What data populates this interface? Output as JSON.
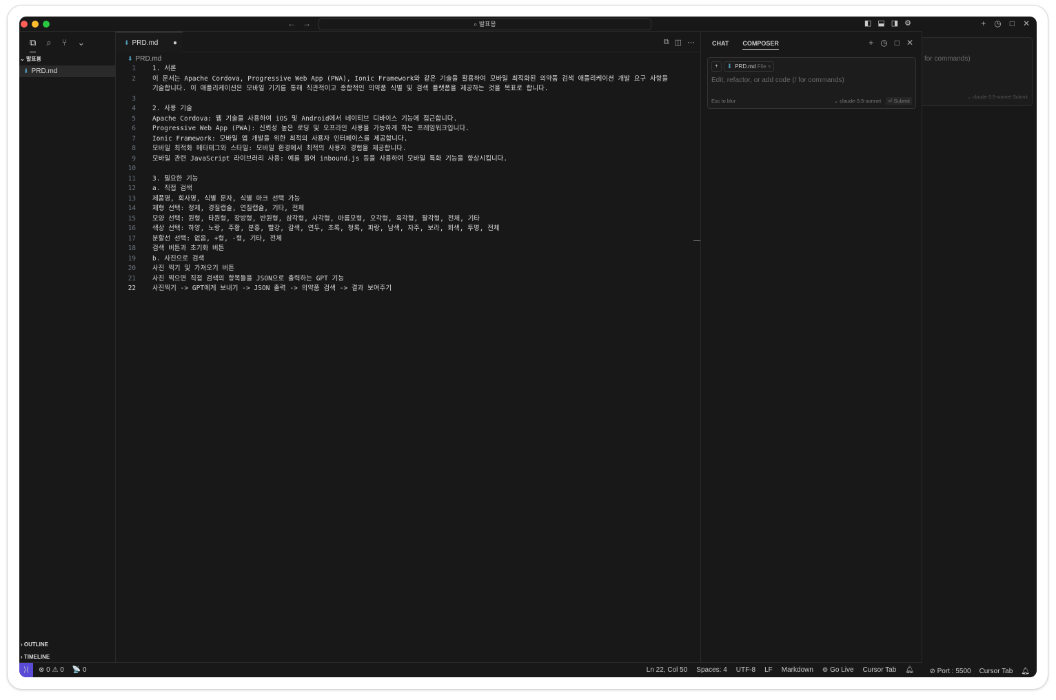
{
  "window": {
    "search": "⌕ 발표용",
    "nav_back": "←",
    "nav_fwd": "→"
  },
  "sidebar": {
    "folder": "발표용",
    "file": "PRD.md",
    "outline": "OUTLINE",
    "timeline": "TIMELINE"
  },
  "editor": {
    "tab": "PRD.md",
    "dirty": "●",
    "breadcrumb": "PRD.md",
    "lines": [
      {
        "n": "1",
        "t": "1. 서론"
      },
      {
        "n": "2",
        "t": "이 문서는 Apache Cordova, Progressive Web App (PWA), Ionic Framework와 같은 기술을 활용하여 모바일 최적화된 의약품 검색 애플리케이션 개발 요구 사항을"
      },
      {
        "n": "",
        "t": "기술합니다. 이 애플리케이션은 모바일 기기를 통해 직관적이고 종합적인 의약품 식별 및 검색 플랫폼을 제공하는 것을 목표로 합니다."
      },
      {
        "n": "3",
        "t": ""
      },
      {
        "n": "4",
        "t": "2. 사용 기술"
      },
      {
        "n": "5",
        "t": "Apache Cordova: 웹 기술을 사용하여 iOS 및 Android에서 네이티브 디바이스 기능에 접근합니다."
      },
      {
        "n": "6",
        "t": "Progressive Web App (PWA): 신뢰성 높은 로딩 및 오프라인 사용을 가능하게 하는 프레임워크입니다."
      },
      {
        "n": "7",
        "t": "Ionic Framework: 모바일 앱 개발을 위한 최적의 사용자 인터페이스를 제공합니다."
      },
      {
        "n": "8",
        "t": "모바일 최적화 메타태그와 스타일: 모바일 환경에서 최적의 사용자 경험을 제공합니다."
      },
      {
        "n": "9",
        "t": "모바일 관련 JavaScript 라이브러리 사용: 예를 들어 inbound.js 등을 사용하여 모바일 특화 기능을 향상시킵니다."
      },
      {
        "n": "10",
        "t": ""
      },
      {
        "n": "11",
        "t": "3. 필요한 기능"
      },
      {
        "n": "12",
        "t": "a. 직접 검색"
      },
      {
        "n": "13",
        "t": "제품명, 회사명, 식별 문자, 식별 마크 선택 가능"
      },
      {
        "n": "14",
        "t": "제형 선택: 정제, 경질캡슐, 연질캡슐, 기타, 전체"
      },
      {
        "n": "15",
        "t": "모양 선택: 원형, 타원형, 장방형, 반원형, 삼각형, 사각형, 마름모형, 오각형, 육각형, 팔각형, 전체, 기타"
      },
      {
        "n": "16",
        "t": "색상 선택: 하양, 노랑, 주황, 분홍, 빨강, 갈색, 연두, 초록, 청록, 파랑, 남색, 자주, 보라, 회색, 투명, 전체"
      },
      {
        "n": "17",
        "t": "분할선 선택: 없음, +형, -형, 기타, 전체"
      },
      {
        "n": "18",
        "t": "검색 버튼과 초기화 버튼"
      },
      {
        "n": "19",
        "t": "b. 사진으로 검색"
      },
      {
        "n": "20",
        "t": "사진 찍기 및 가져오기 버튼"
      },
      {
        "n": "21",
        "t": "사진 찍으면 직접 검색의 항목들을 JSON으로 출력하는 GPT 기능"
      },
      {
        "n": "22",
        "t": "사진찍기 -> GPT에게 보내기 -> JSON 출력 -> 의약품 검색 -> 결과 보여주기"
      }
    ]
  },
  "composer": {
    "tab_chat": "CHAT",
    "tab_composer": "COMPOSER",
    "chip_file": "PRD.md",
    "chip_type": "File",
    "placeholder": "Edit, refactor, or add code (/ for commands)",
    "esc": "Esc to blur",
    "model": "⌄ claude-3.5-sonnet",
    "submit": "⏎ Submit"
  },
  "status": {
    "errors": "⊗ 0",
    "warnings": "⚠ 0",
    "ports": "📡 0",
    "position": "Ln 22, Col 50",
    "spaces": "Spaces: 4",
    "encoding": "UTF-8",
    "eol": "LF",
    "language": "Markdown",
    "golive": "Go Live",
    "cursor_tab": "Cursor Tab"
  },
  "bg_window": {
    "placeholder": "for commands)",
    "model": "⌄ claude-3.5-sonnet",
    "submit": "Submit",
    "port": "⊘ Port : 5500",
    "cursor_tab": "Cursor Tab"
  }
}
